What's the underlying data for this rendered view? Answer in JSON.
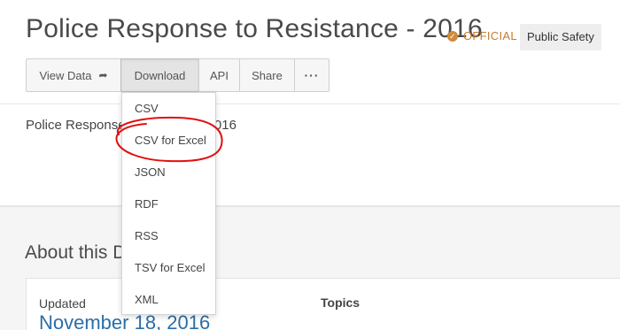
{
  "header": {
    "title": "Police Response to Resistance - 2016",
    "official_label": "OFFICIAL",
    "tag": "Public Safety"
  },
  "toolbar": {
    "view_data": "View Data",
    "download": "Download",
    "api": "API",
    "share": "Share",
    "more": "···"
  },
  "description": {
    "left": "Police Response",
    "right": "2016"
  },
  "download_menu": {
    "items": [
      "CSV",
      "CSV for Excel",
      "JSON",
      "RDF",
      "RSS",
      "TSV for Excel",
      "XML"
    ]
  },
  "about": {
    "heading": "About this D",
    "updated_label": "Updated",
    "updated_value": "November 18, 2016",
    "topics_label": "Topics"
  },
  "colors": {
    "official": "#c57b2f",
    "link": "#2a6ea8",
    "annotation": "#e01010"
  }
}
